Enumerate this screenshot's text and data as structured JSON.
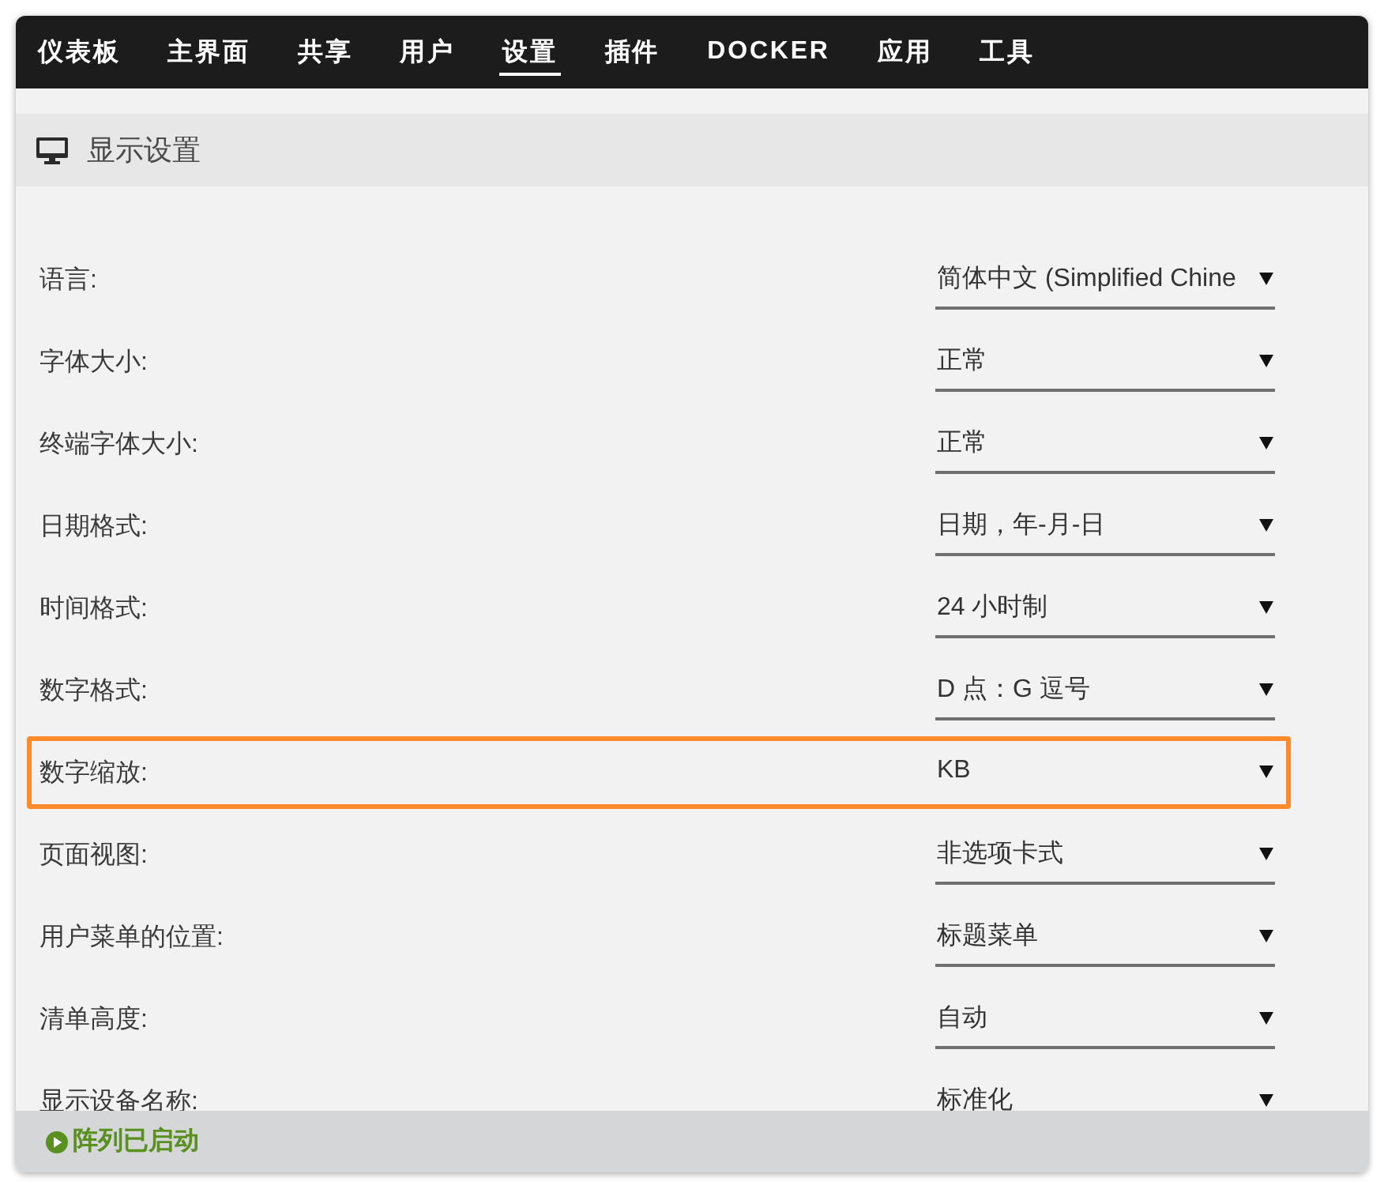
{
  "nav": {
    "tabs": [
      {
        "label": "仪表板",
        "selected": false
      },
      {
        "label": "主界面",
        "selected": false
      },
      {
        "label": "共享",
        "selected": false
      },
      {
        "label": "用户",
        "selected": false
      },
      {
        "label": "设置",
        "selected": true
      },
      {
        "label": "插件",
        "selected": false
      },
      {
        "label": "DOCKER",
        "selected": false
      },
      {
        "label": "应用",
        "selected": false
      },
      {
        "label": "工具",
        "selected": false
      }
    ]
  },
  "panel": {
    "title": "显示设置"
  },
  "settings": [
    {
      "label": "语言:",
      "value": "简体中文 (Simplified Chine",
      "highlighted": false
    },
    {
      "label": "字体大小:",
      "value": "正常",
      "highlighted": false
    },
    {
      "label": "终端字体大小:",
      "value": "正常",
      "highlighted": false
    },
    {
      "label": "日期格式:",
      "value": "日期，年-月-日",
      "highlighted": false
    },
    {
      "label": "时间格式:",
      "value": "24 小时制",
      "highlighted": false
    },
    {
      "label": "数字格式:",
      "value": "D 点：G 逗号",
      "highlighted": false
    },
    {
      "label": "数字缩放:",
      "value": "KB",
      "highlighted": true
    },
    {
      "label": "页面视图:",
      "value": "非选项卡式",
      "highlighted": false
    },
    {
      "label": "用户菜单的位置:",
      "value": "标题菜单",
      "highlighted": false
    },
    {
      "label": "清单高度:",
      "value": "自动",
      "highlighted": false
    },
    {
      "label": "显示设备名称:",
      "value": "标准化",
      "highlighted": false
    }
  ],
  "status_bar": {
    "text": "阵列已启动"
  }
}
